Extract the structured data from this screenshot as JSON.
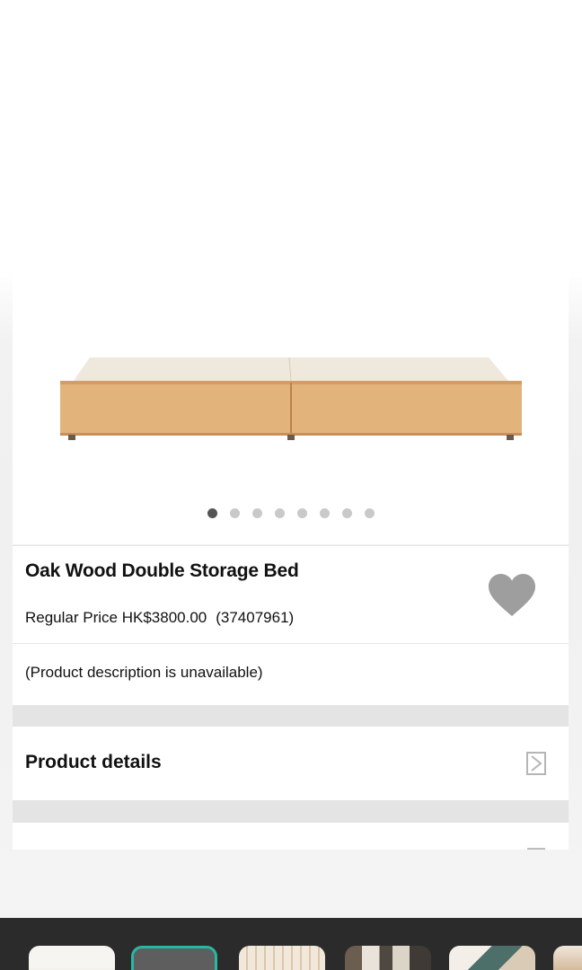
{
  "carousel": {
    "dot_count": 8,
    "active_index": 0
  },
  "product": {
    "title": "Oak Wood Double Storage Bed",
    "price_label": "Regular Price HK$3800.00",
    "product_code": "(37407961)",
    "description": "(Product description is unavailable)",
    "favorite_icon": "heart-icon"
  },
  "sections": {
    "details_label": "Product details",
    "details_icon": "chevron-right-icon"
  },
  "thumbnails": {
    "count": 6,
    "selected_index": 1
  },
  "colors": {
    "accent": "#27b7a4",
    "heart": "#9e9e9e",
    "thumb_bar": "#2b2b2b"
  }
}
